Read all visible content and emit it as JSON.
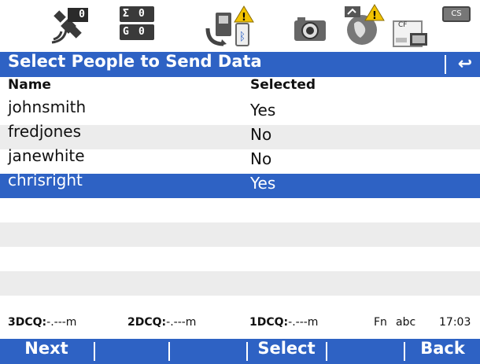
{
  "statusbar": {
    "satellites_count": "0",
    "sum_label": "Σ",
    "sum_value": "0",
    "g_label": "G",
    "g_value": "0",
    "cf_label": "CF",
    "cs_label": "CS",
    "warning_color": "#f2c200"
  },
  "title": {
    "text": "Select People to Send Data",
    "back_glyph": "↩"
  },
  "table": {
    "headers": {
      "name": "Name",
      "selected": "Selected"
    },
    "rows": [
      {
        "name": "johnsmith",
        "selected": "Yes"
      },
      {
        "name": "fredjones",
        "selected": "No"
      },
      {
        "name": "janewhite",
        "selected": "No"
      },
      {
        "name": "chrisright",
        "selected": "Yes"
      }
    ],
    "selected_row_index": 3
  },
  "infobar": {
    "q3d_label": "3DCQ:",
    "q3d_value": "-.---m",
    "q2d_label": "2DCQ:",
    "q2d_value": "-.---m",
    "q1d_label": "1DCQ:",
    "q1d_value": "-.---m",
    "fn": "Fn",
    "input_mode": "abc",
    "time": "17:03"
  },
  "softkeys": {
    "f1": "Next",
    "f2": "",
    "f3": "",
    "f4": "Select",
    "f5": "",
    "f6": "Back"
  },
  "colors": {
    "accent": "#2e62c4",
    "stripe": "#ececec"
  }
}
